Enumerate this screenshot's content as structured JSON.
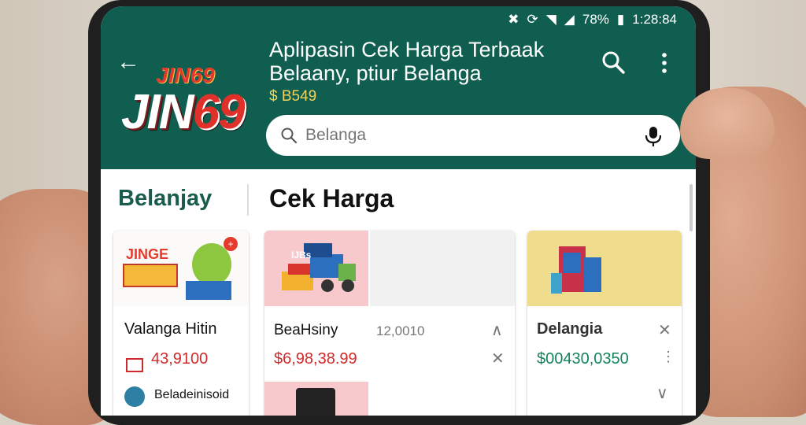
{
  "status_bar": {
    "battery": "78%",
    "time": "1:28:84"
  },
  "header": {
    "title": "Aplipasin Cek Harga Terbaak Belaany, ptiur Belanga",
    "badge_price": "$ B549",
    "logo_small": "JIN69",
    "logo_big_part1": "JIN",
    "logo_big_part2": "69"
  },
  "search": {
    "placeholder": "Belanga"
  },
  "sections": {
    "left": "Belanjay",
    "right": "Cek Harga"
  },
  "cards": [
    {
      "thumb_logo": "JINGE",
      "title": "Valanga Hitin",
      "price": "43,9100",
      "seller": "Beladeinisoid"
    },
    {
      "thumb_label": "IJBs",
      "title": "BeaHsiny",
      "sub_value": "12,0010",
      "price": "$6,98,38.99"
    },
    {
      "title": "Delangia",
      "price": "$00430,0350"
    }
  ],
  "colors": {
    "appbar": "#0f5e4f",
    "accent_red": "#d02a2a",
    "accent_green": "#13855b",
    "price_badge": "#f2d35c"
  }
}
